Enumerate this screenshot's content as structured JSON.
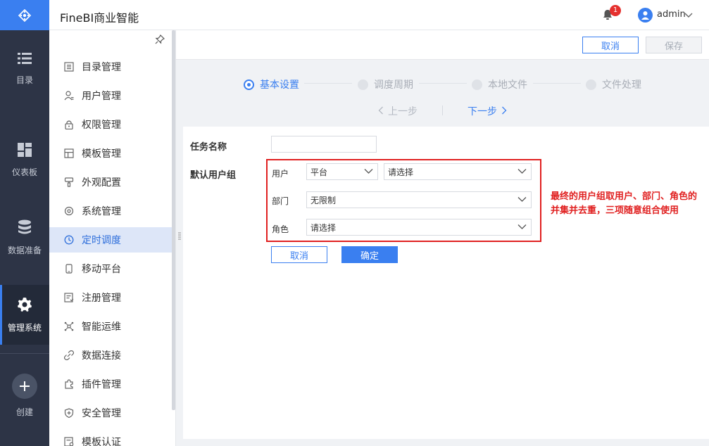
{
  "app": {
    "title": "FineBI商业智能"
  },
  "header": {
    "notification_count": "1",
    "user_name": "admin"
  },
  "nav": {
    "items": [
      {
        "label": "目录",
        "icon": "list-icon"
      },
      {
        "label": "仪表板",
        "icon": "dashboard-icon"
      },
      {
        "label": "数据准备",
        "icon": "database-icon"
      },
      {
        "label": "管理系统",
        "icon": "gear-icon",
        "active": true
      },
      {
        "label": "创建",
        "icon": "plus-icon"
      }
    ]
  },
  "menu": {
    "items": [
      {
        "label": "目录管理",
        "icon": "catalog-icon"
      },
      {
        "label": "用户管理",
        "icon": "user-icon"
      },
      {
        "label": "权限管理",
        "icon": "lock-icon"
      },
      {
        "label": "模板管理",
        "icon": "template-icon"
      },
      {
        "label": "外观配置",
        "icon": "brush-icon"
      },
      {
        "label": "系统管理",
        "icon": "settings-icon"
      },
      {
        "label": "定时调度",
        "icon": "clock-icon",
        "active": true
      },
      {
        "label": "移动平台",
        "icon": "mobile-icon"
      },
      {
        "label": "注册管理",
        "icon": "register-icon"
      },
      {
        "label": "智能运维",
        "icon": "ops-icon"
      },
      {
        "label": "数据连接",
        "icon": "link-icon"
      },
      {
        "label": "插件管理",
        "icon": "plugin-icon"
      },
      {
        "label": "安全管理",
        "icon": "shield-icon"
      },
      {
        "label": "模板认证",
        "icon": "certify-icon"
      }
    ]
  },
  "toolbar": {
    "cancel_label": "取消",
    "save_label": "保存"
  },
  "steps": {
    "items": [
      {
        "label": "基本设置",
        "current": true
      },
      {
        "label": "调度周期"
      },
      {
        "label": "本地文件"
      },
      {
        "label": "文件处理"
      }
    ],
    "prev_label": "上一步",
    "next_label": "下一步"
  },
  "form": {
    "task_name_label": "任务名称",
    "task_name_value": "",
    "default_group_label": "默认用户组",
    "user_label": "用户",
    "user_type_value": "平台",
    "user_select_value": "请选择",
    "dept_label": "部门",
    "dept_value": "无限制",
    "role_label": "角色",
    "role_value": "请选择",
    "cancel_label": "取消",
    "confirm_label": "确定"
  },
  "annotation": {
    "text": "最终的用户组取用户、部门、角色的并集并去重，三项随意组合使用"
  },
  "colors": {
    "accent": "#3a7ff0",
    "nav_bg": "#2d3446",
    "annotation": "#e02020",
    "badge": "#e5302e"
  }
}
